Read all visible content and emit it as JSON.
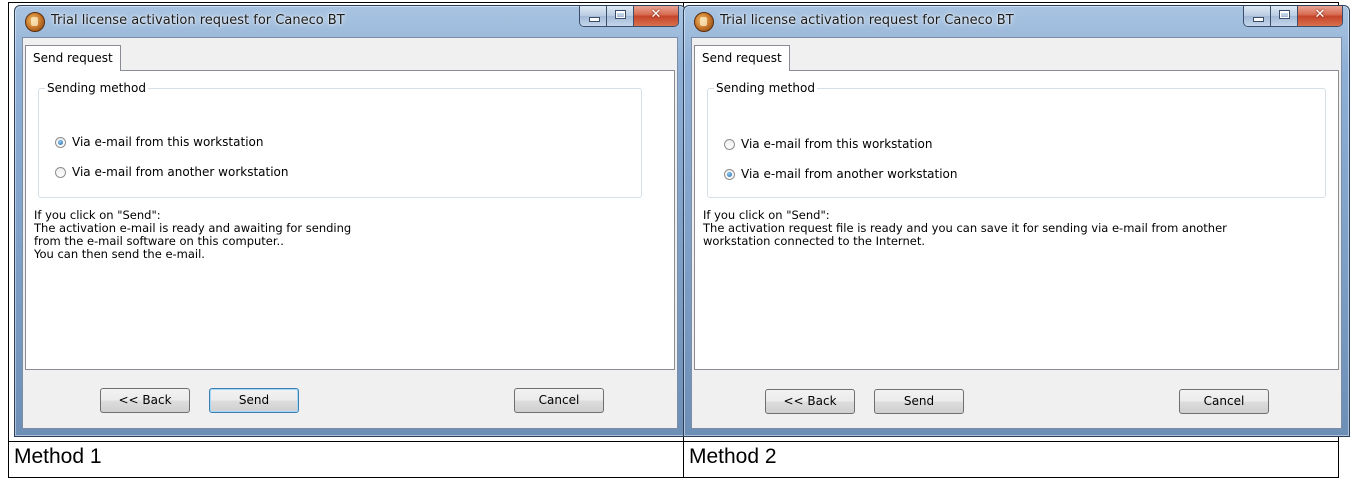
{
  "windows": [
    {
      "title": "Trial license activation request for Caneco BT",
      "tab_label": "Send request",
      "group_label": "Sending method",
      "options": [
        {
          "label": "Via e-mail from this workstation",
          "selected": true
        },
        {
          "label": "Via e-mail from another workstation",
          "selected": false
        }
      ],
      "info_lines": [
        "If you click on \"Send\":",
        "The activation e-mail is ready and awaiting for sending",
        "from the e-mail software on this computer..",
        "You can then send the e-mail."
      ],
      "buttons": {
        "back": "<< Back",
        "send": "Send",
        "cancel": "Cancel"
      },
      "default_button": "send"
    },
    {
      "title": "Trial license activation request for Caneco BT",
      "tab_label": "Send request",
      "group_label": "Sending method",
      "options": [
        {
          "label": "Via e-mail from this workstation",
          "selected": false
        },
        {
          "label": "Via e-mail from another workstation",
          "selected": true
        }
      ],
      "info_lines": [
        "If you click on \"Send\":",
        "The activation request file is ready and you can save it for sending via e-mail from another",
        "workstation connected to the Internet."
      ],
      "buttons": {
        "back": "<< Back",
        "send": "Send",
        "cancel": "Cancel"
      },
      "default_button": ""
    }
  ],
  "captions": [
    "Method 1",
    "Method 2"
  ],
  "icons": {
    "app": "caneco-app-icon",
    "minimize": "minimize-icon",
    "maximize": "maximize-icon",
    "close": "close-icon"
  },
  "colors": {
    "titlebar": "#9ebbdc",
    "close_button": "#c4432a",
    "default_button_border": "#3c7fb1"
  }
}
